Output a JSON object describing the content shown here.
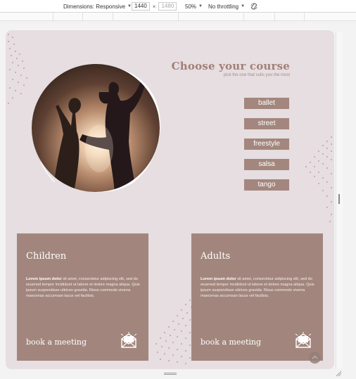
{
  "devtools": {
    "dimensions_label": "Dimensions: Responsive",
    "width_value": "1440",
    "height_value": "1480",
    "zoom_label": "50%",
    "throttle_label": "No throttling",
    "times_sign": "×"
  },
  "hero": {
    "title": "Choose your course",
    "subtitle": "pick the one that suits you the most"
  },
  "courses": [
    {
      "label": "ballet"
    },
    {
      "label": "street"
    },
    {
      "label": "freestyle"
    },
    {
      "label": "salsa"
    },
    {
      "label": "tango"
    }
  ],
  "cards": [
    {
      "title": "Children",
      "body_bold": "Lorem ipsum dolor",
      "body_text": " sit amet, consectetur adipiscing elit, sed do eiusmod tempor incididunt ut labore et dolore magna aliqua. Quis ipsum suspendisse ultrices gravida. Risus commodo viverra maecenas accumsan lacus vel facilisis.",
      "cta": "book a meeting"
    },
    {
      "title": "Adults",
      "body_bold": "Lorem ipsum dolor",
      "body_text": " sit amet, consectetur adipiscing elit, sed do eiusmod tempor incididunt ut labore et dolore magna aliqua. Quis ipsum suspendisse ultrices gravida. Risus commodo viverra maecenas accumsan lacus vel facilisis.",
      "cta": "book a meeting"
    }
  ],
  "icons": {
    "mail": "mail-icon",
    "rotate": "rotate-icon",
    "scroll_up": "arrow-up-icon"
  },
  "colors": {
    "page_bg": "#e6dee0",
    "accent": "#a3867d",
    "title": "#a27f78"
  }
}
